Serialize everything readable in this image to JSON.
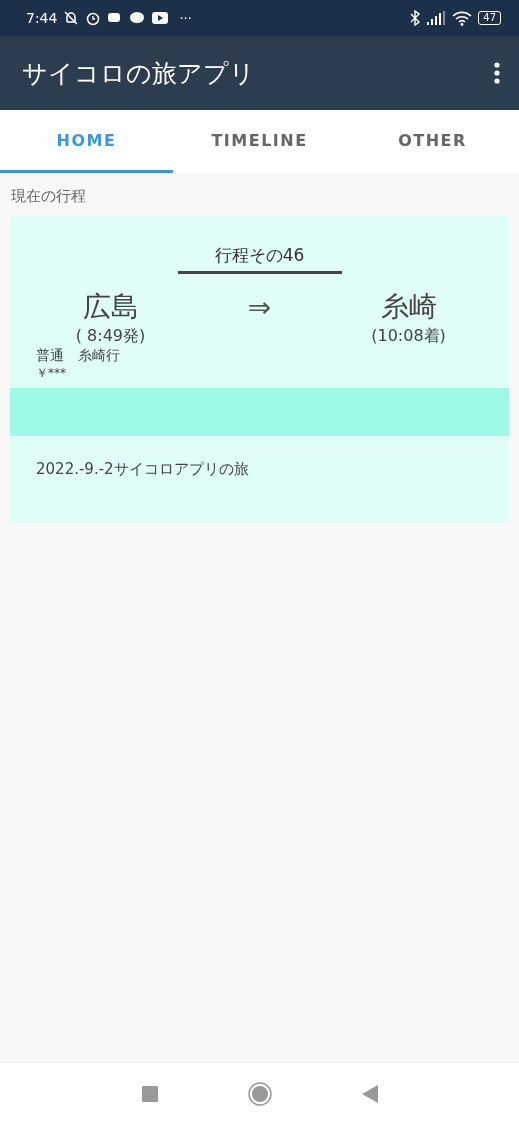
{
  "status_bar": {
    "time": "7:44",
    "more": "···",
    "battery": "47"
  },
  "app_bar": {
    "title": "サイコロの旅アプリ"
  },
  "tabs": [
    {
      "label": "HOME",
      "selected": true
    },
    {
      "label": "TIMELINE",
      "selected": false
    },
    {
      "label": "OTHER",
      "selected": false
    }
  ],
  "section_label": "現在の行程",
  "card": {
    "title": "行程その46",
    "from": "広島",
    "arrow": "⇒",
    "to": "糸崎",
    "depart": "( 8:49発)",
    "arrive": "(10:08着)",
    "train": "普通　糸崎行",
    "fare": "￥***",
    "footer": "2022.-9.-2サイコロアプリの旅"
  }
}
